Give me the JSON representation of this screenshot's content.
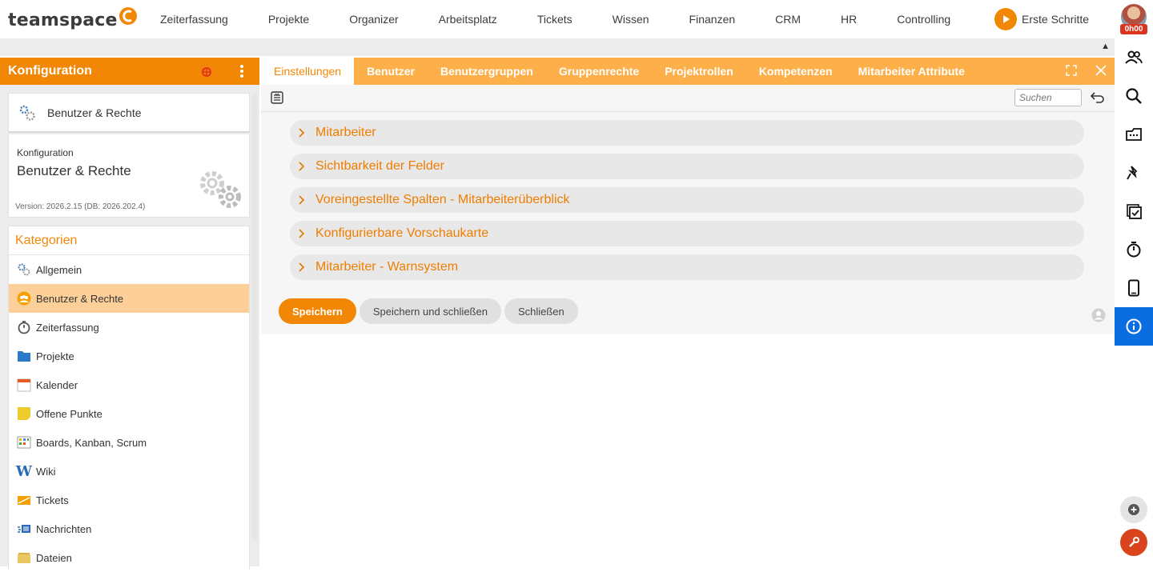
{
  "app": {
    "logo_text": "teamspace"
  },
  "topnav": {
    "items": [
      "Zeiterfassung",
      "Projekte",
      "Organizer",
      "Arbeitsplatz",
      "Tickets",
      "Wissen",
      "Finanzen",
      "CRM",
      "HR",
      "Controlling"
    ],
    "first_steps": "Erste Schritte",
    "time_badge": "0h00"
  },
  "left_panel": {
    "title": "Konfiguration",
    "nav_card_label": "Benutzer & Rechte",
    "info": {
      "subtitle": "Konfiguration",
      "title": "Benutzer & Rechte",
      "version": "Version: 2026.2.15 (DB: 2026.202.4)"
    },
    "categories_title": "Kategorien",
    "categories": [
      {
        "label": "Allgemein",
        "icon": "gears-icon"
      },
      {
        "label": "Benutzer & Rechte",
        "icon": "users-icon",
        "active": true
      },
      {
        "label": "Zeiterfassung",
        "icon": "stopwatch-icon"
      },
      {
        "label": "Projekte",
        "icon": "folder-icon"
      },
      {
        "label": "Kalender",
        "icon": "calendar-icon"
      },
      {
        "label": "Offene Punkte",
        "icon": "sticky-note-icon"
      },
      {
        "label": "Boards, Kanban, Scrum",
        "icon": "board-icon"
      },
      {
        "label": "Wiki",
        "icon": "wiki-icon"
      },
      {
        "label": "Tickets",
        "icon": "ticket-icon"
      },
      {
        "label": "Nachrichten",
        "icon": "messages-icon"
      },
      {
        "label": "Dateien",
        "icon": "files-icon"
      }
    ]
  },
  "tabs": [
    "Einstellungen",
    "Benutzer",
    "Benutzergruppen",
    "Gruppenrechte",
    "Projektrollen",
    "Kompetenzen",
    "Mitarbeiter Attribute"
  ],
  "toolbar": {
    "search_placeholder": "Suchen"
  },
  "sections": [
    "Mitarbeiter",
    "Sichtbarkeit der Felder",
    "Voreingestellte Spalten - Mitarbeiterüberblick",
    "Konfigurierbare Vorschaukarte",
    "Mitarbeiter - Warnsystem"
  ],
  "buttons": {
    "save": "Speichern",
    "save_close": "Speichern und schließen",
    "close": "Schließen"
  },
  "colors": {
    "accent": "#f28705",
    "tab_bar": "#fdaf4a",
    "active_category": "#fdd09a",
    "info_active": "#0b6ee0",
    "wrench": "#d9441c"
  }
}
